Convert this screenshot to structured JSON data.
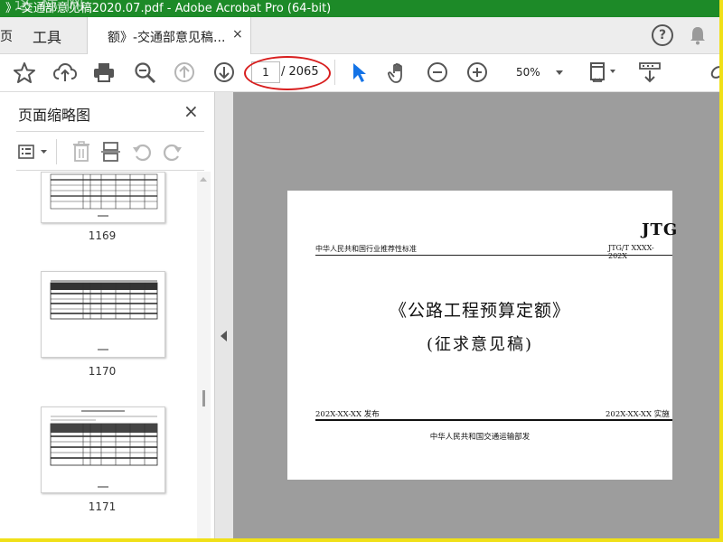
{
  "window": {
    "title": "》-交通部意见稿2020.07.pdf - Adobe Acrobat Pro (64-bit)",
    "watermark": "这 标 网"
  },
  "menubar": {
    "home_fragment": "页",
    "tools_label": "工具",
    "doc_tab_label": "额》-交通部意见稿...",
    "doc_tab_close": "×",
    "help_label": "?"
  },
  "toolbar": {
    "page_current": "1",
    "page_total": "/ 2065",
    "zoom_value": "50%",
    "icons": [
      "star-icon",
      "upload-cloud-icon",
      "print-icon",
      "zoom-search-icon",
      "page-up-icon",
      "page-down-icon",
      "select-arrow-icon",
      "hand-icon",
      "zoom-out-icon",
      "zoom-in-icon",
      "fit-page-icon",
      "scroll-mode-icon",
      "link-icon"
    ]
  },
  "sidebar": {
    "title": "页面缩略图",
    "close": "×",
    "thumbnails": [
      {
        "number": "1169"
      },
      {
        "number": "1170"
      },
      {
        "number": "1171"
      }
    ]
  },
  "document_page": {
    "jtg": "JTG",
    "std_left": "中华人民共和国行业推荐性标准",
    "std_right": "JTG/T XXXX-202X",
    "title": "《公路工程预算定额》",
    "subtitle": "(征求意见稿)",
    "issue_date": "202X-XX-XX 发布",
    "effective_date": "202X-XX-XX 实施",
    "publisher": "中华人民共和国交通运输部发"
  },
  "colors": {
    "titlebar": "#1d8a28",
    "accent_blue": "#1473e6",
    "annotation_red": "#d81e1e",
    "canvas_gray": "#9d9d9d"
  }
}
